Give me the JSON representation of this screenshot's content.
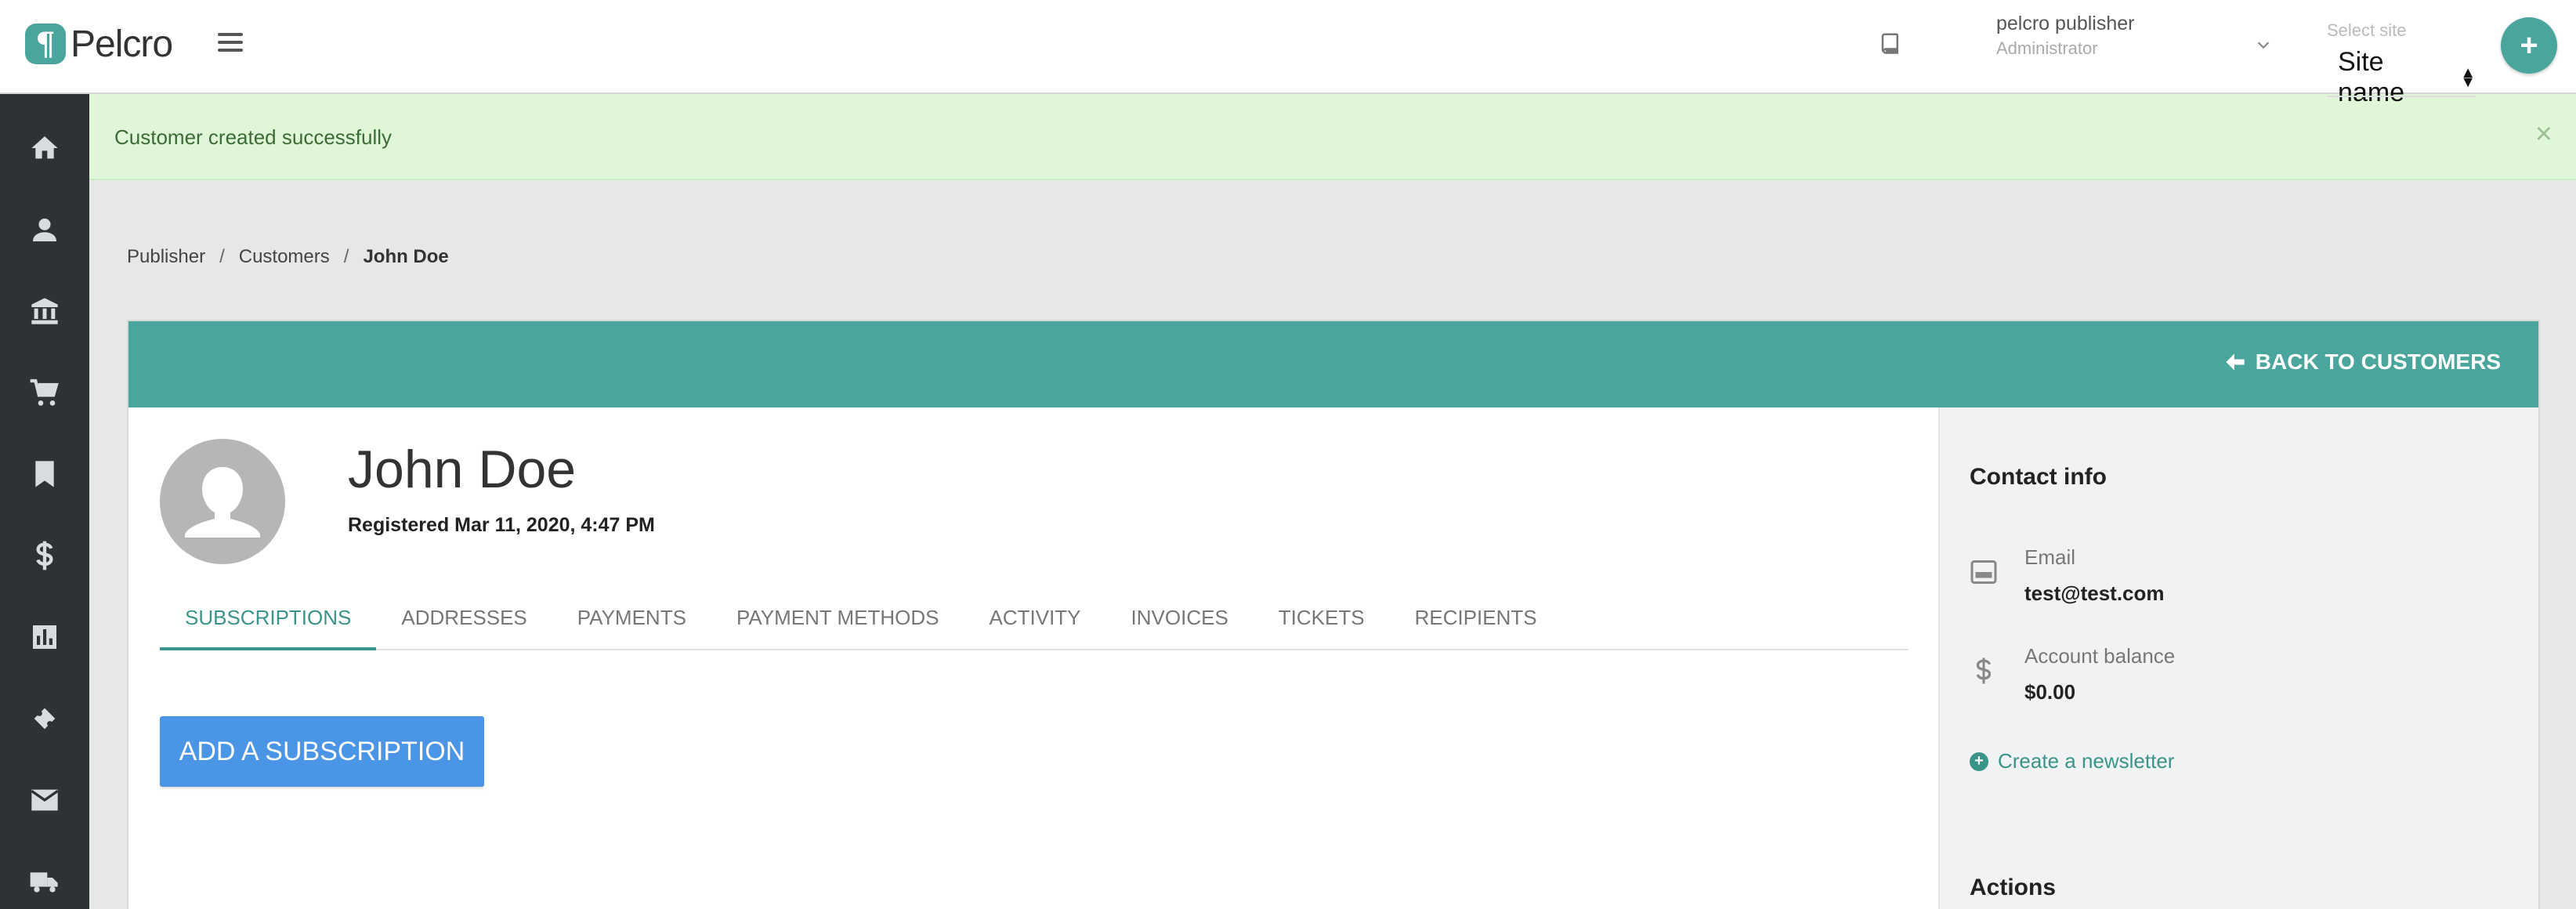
{
  "header": {
    "logo_text": "Pelcro",
    "logo_mark": "¶",
    "user_name": "pelcro publisher",
    "user_role": "Administrator",
    "site_label": "Select site",
    "site_name": "Site name",
    "plus_label": "+"
  },
  "sidebar": {
    "items": [
      {
        "name": "home",
        "icon": "home-icon"
      },
      {
        "name": "customers",
        "icon": "person-icon"
      },
      {
        "name": "bank",
        "icon": "bank-icon"
      },
      {
        "name": "cart",
        "icon": "cart-icon"
      },
      {
        "name": "bookmark",
        "icon": "bookmark-icon"
      },
      {
        "name": "dollar",
        "icon": "dollar-icon"
      },
      {
        "name": "chart",
        "icon": "bar-chart-icon"
      },
      {
        "name": "ticket",
        "icon": "ticket-icon"
      },
      {
        "name": "mail",
        "icon": "mail-icon"
      },
      {
        "name": "truck",
        "icon": "truck-icon"
      }
    ]
  },
  "alert": {
    "message": "Customer created successfully",
    "close": "×"
  },
  "breadcrumb": {
    "items": [
      "Publisher",
      "Customers",
      "John Doe"
    ],
    "separator": "/"
  },
  "card": {
    "back_label": "BACK TO CUSTOMERS",
    "customer_name": "John Doe",
    "registered": "Registered Mar 11, 2020, 4:47 PM",
    "tabs": [
      "SUBSCRIPTIONS",
      "ADDRESSES",
      "PAYMENTS",
      "PAYMENT METHODS",
      "ACTIVITY",
      "INVOICES",
      "TICKETS",
      "RECIPIENTS"
    ],
    "active_tab": "SUBSCRIPTIONS",
    "add_subscription_label": "ADD A SUBSCRIPTION"
  },
  "contact": {
    "title": "Contact info",
    "email_label": "Email",
    "email_value": "test@test.com",
    "balance_label": "Account balance",
    "balance_value": "$0.00",
    "newsletter_label": "Create a newsletter",
    "actions_title": "Actions"
  },
  "colors": {
    "accent": "#4aa69d",
    "sidebar": "#2e3136",
    "alert_bg": "#dff7d8",
    "button_blue": "#4a95e6"
  }
}
